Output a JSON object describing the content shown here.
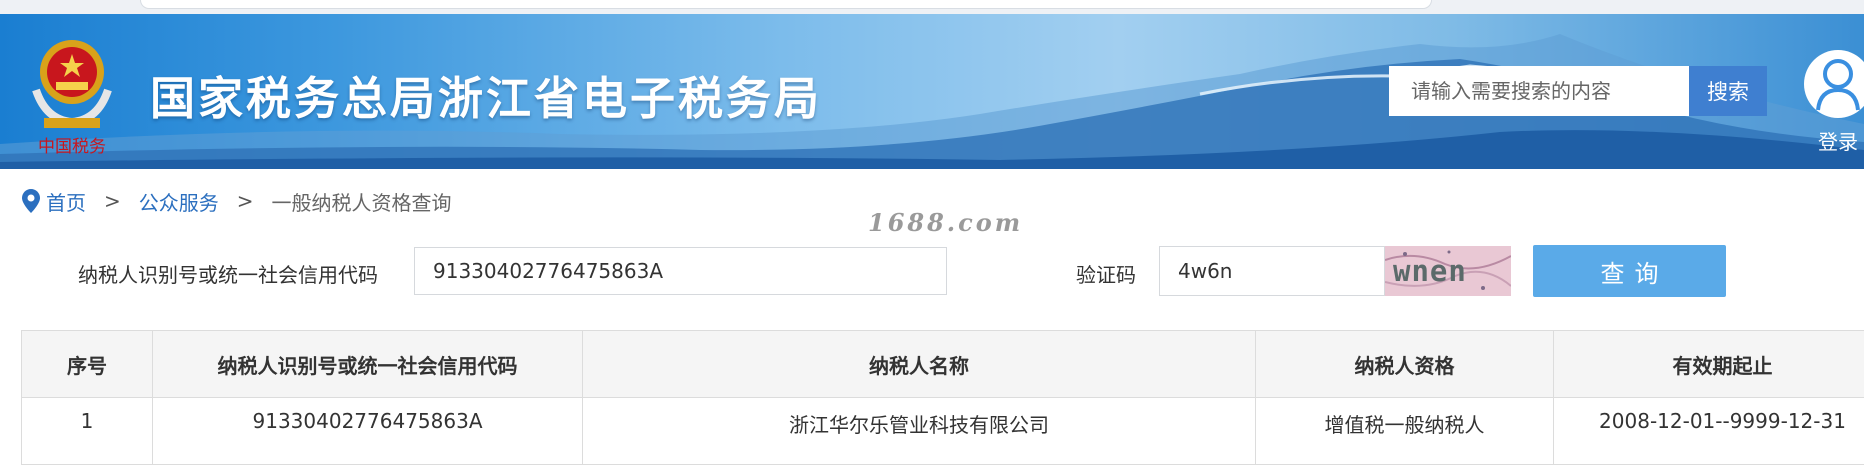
{
  "header": {
    "title": "国家税务总局浙江省电子税务局",
    "emblem_caption": "中国税务",
    "search": {
      "placeholder": "请输入需要搜索的内容",
      "button_label": "搜索"
    },
    "login_label": "登录"
  },
  "breadcrumb": {
    "home": "首页",
    "separator": ">",
    "section": "公众服务",
    "current": "一般纳税人资格查询"
  },
  "watermark": "1688.com",
  "form": {
    "taxpayer_id_label": "纳税人识别号或统一社会信用代码",
    "taxpayer_id_value": "91330402776475863A",
    "captcha_label": "验证码",
    "captcha_value": "4w6n",
    "captcha_image_text": "wnen",
    "query_button_label": "查询"
  },
  "table": {
    "headers": [
      "序号",
      "纳税人识别号或统一社会信用代码",
      "纳税人名称",
      "纳税人资格",
      "有效期起止"
    ],
    "rows": [
      [
        "1",
        "91330402776475863A",
        "浙江华尔乐管业科技有限公司",
        "增值税一般纳税人",
        "2008-12-01--9999-12-31"
      ]
    ]
  },
  "colors": {
    "banner_start": "#1a7ed1",
    "banner_end": "#3b8fd4",
    "search_button": "#3f7fd0",
    "query_button": "#5aaae8",
    "link": "#2b6fbf"
  },
  "icons": {
    "emblem": "national-tax-emblem",
    "login": "user-avatar-icon",
    "breadcrumb": "location-pin-icon"
  }
}
